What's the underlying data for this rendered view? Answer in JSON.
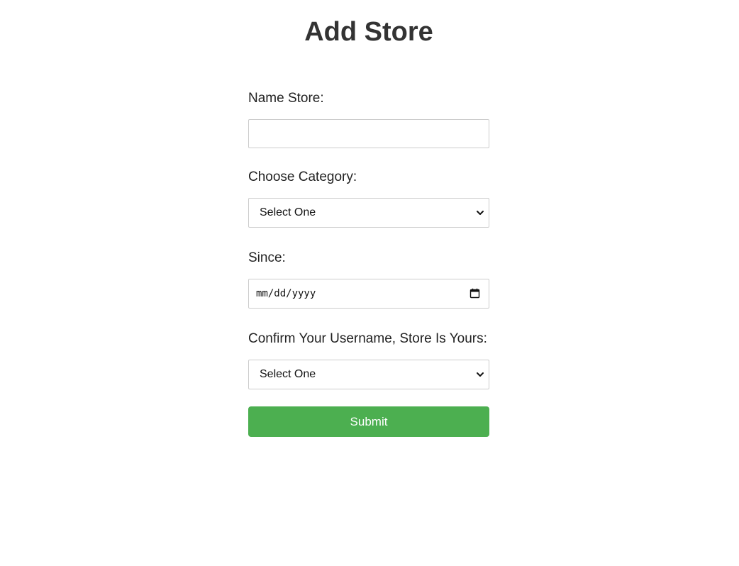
{
  "page": {
    "title": "Add Store"
  },
  "form": {
    "name_store": {
      "label": "Name Store:",
      "value": ""
    },
    "category": {
      "label": "Choose Category:",
      "selected": "Select One"
    },
    "since": {
      "label": "Since:",
      "placeholder": "mm/dd/yyyy"
    },
    "confirm_username": {
      "label": "Confirm Your Username, Store Is Yours:",
      "selected": "Select One"
    },
    "submit_label": "Submit"
  },
  "icons": {
    "select_arrow": "chevron-down-icon",
    "date_picker": "calendar-icon"
  },
  "colors": {
    "submit_background": "#4caf50",
    "submit_text": "#ffffff",
    "field_border": "#cccccc",
    "title_text": "#333333"
  }
}
